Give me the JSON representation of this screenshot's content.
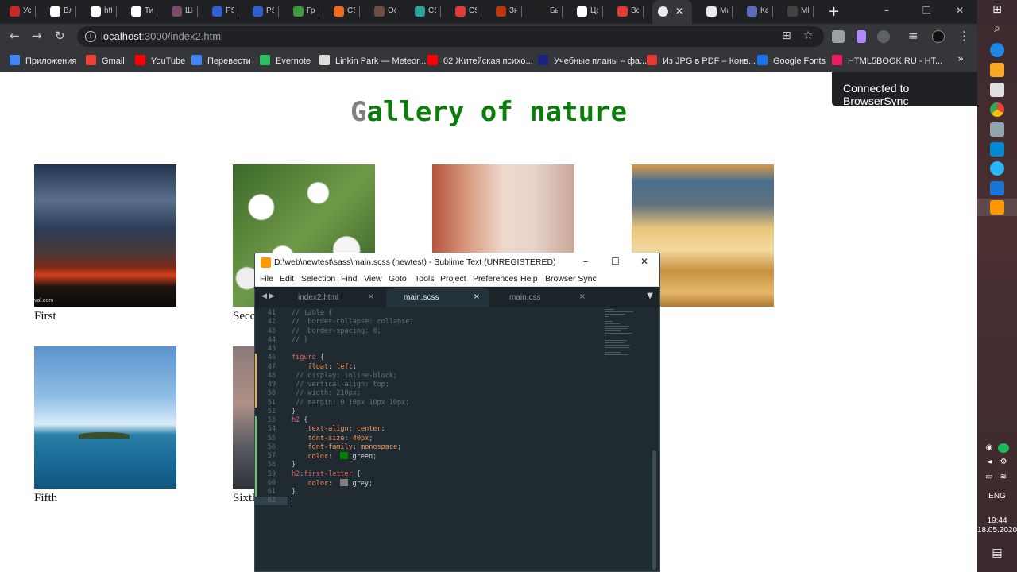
{
  "browser": {
    "tabs": [
      {
        "label": "Усл",
        "color": "#c62828"
      },
      {
        "label": "Вло",
        "color": "#ffffff"
      },
      {
        "label": "http",
        "color": "#ffffff"
      },
      {
        "label": "Тип",
        "color": "#ffffff"
      },
      {
        "label": "Шп",
        "color": "#7b4a6a"
      },
      {
        "label": "PSD",
        "color": "#2f5fd0"
      },
      {
        "label": "PSD",
        "color": "#2f5fd0"
      },
      {
        "label": "Гра",
        "color": "#3e9a3e"
      },
      {
        "label": "CSS",
        "color": "#f06a1c"
      },
      {
        "label": "Осн",
        "color": "#6d4c41"
      },
      {
        "label": "CSS",
        "color": "#26a69a"
      },
      {
        "label": "CSS",
        "color": "#e53935"
      },
      {
        "label": "Зна",
        "color": "#bf360c"
      },
      {
        "label": "Был",
        "color": "#212121"
      },
      {
        "label": "Цен",
        "color": "#ffffff"
      },
      {
        "label": "Все",
        "color": "#e53935"
      },
      {
        "label": "",
        "color": "#e8eaed",
        "active": true,
        "close": "✕"
      },
      {
        "label": "Mai",
        "color": "#e8eaed"
      },
      {
        "label": "Как",
        "color": "#5c6bc0"
      },
      {
        "label": "MP3",
        "color": "#424242"
      }
    ],
    "new_tab": "+",
    "window_controls": {
      "minimize": "–",
      "restore": "❐",
      "close": "✕"
    },
    "url_host": "localhost",
    "url_path": ":3000/index2.html",
    "bookmarks": [
      {
        "label": "Приложения",
        "color": "#4285f4"
      },
      {
        "label": "Gmail",
        "color": "#ea4335"
      },
      {
        "label": "YouTube",
        "color": "#ff0000"
      },
      {
        "label": "Перевести",
        "color": "#4285f4"
      },
      {
        "label": "Evernote",
        "color": "#2dbe60"
      },
      {
        "label": "Linkin Park — Meteor...",
        "color": "#dddddd"
      },
      {
        "label": "02 Житейская психо...",
        "color": "#ff0000"
      },
      {
        "label": "Учебные планы – фа...",
        "color": "#1a237e"
      },
      {
        "label": "Из JPG в PDF – Конв...",
        "color": "#e53935"
      },
      {
        "label": "Google Fonts",
        "color": "#1a73e8"
      },
      {
        "label": "HTML5BOOK.RU - НТ...",
        "color": "#e91e63"
      }
    ],
    "bookmarks_more": "»"
  },
  "page": {
    "title_first": "G",
    "title_rest": "allery of nature",
    "title_color": "#008000",
    "first_letter_color": "#808080",
    "notification": "Connected to BrowserSync",
    "figures": [
      {
        "caption": "First",
        "watermark": "val.com"
      },
      {
        "caption": "Seco"
      },
      {
        "caption": ""
      },
      {
        "caption": "n"
      },
      {
        "caption": "Fifth"
      },
      {
        "caption": "Sixth"
      }
    ]
  },
  "sublime": {
    "title": "D:\\web\\newtest\\sass\\main.scss (newtest) - Sublime Text (UNREGISTERED)",
    "buttons": {
      "minimize": "–",
      "maximize": "☐",
      "close": "✕"
    },
    "menu": [
      "File",
      "Edit",
      "Selection",
      "Find",
      "View",
      "Goto",
      "Tools",
      "Project",
      "Preferences",
      "Help",
      "Browser Sync"
    ],
    "tab_arrows": "◀ ▶",
    "tab_dropdown": "▼",
    "tabs": [
      {
        "name": "index2.html",
        "close": "×",
        "active": false
      },
      {
        "name": "main.scss",
        "close": "×",
        "active": true
      },
      {
        "name": "main.css",
        "close": "×",
        "active": false
      }
    ],
    "lines": [
      {
        "n": "41",
        "t": [
          [
            "cm",
            "// table {"
          ]
        ]
      },
      {
        "n": "42",
        "t": [
          [
            "cm",
            "//  border-collapse: collapse;"
          ]
        ]
      },
      {
        "n": "43",
        "t": [
          [
            "cm",
            "//  border-spacing: 0;"
          ]
        ]
      },
      {
        "n": "44",
        "t": [
          [
            "cm",
            "// }"
          ]
        ]
      },
      {
        "n": "45",
        "t": []
      },
      {
        "n": "46",
        "t": [
          [
            "sel",
            "figure"
          ],
          [
            "pn",
            " {"
          ]
        ],
        "git": "modified"
      },
      {
        "n": "47",
        "t": [
          [
            "plain",
            "    "
          ],
          [
            "prop",
            "float"
          ],
          [
            "pn",
            ": "
          ],
          [
            "val",
            "left"
          ],
          [
            "pn",
            ";"
          ]
        ],
        "git": "modified"
      },
      {
        "n": "48",
        "t": [
          [
            "cm",
            " // display: inline-block;"
          ]
        ],
        "git": "modified"
      },
      {
        "n": "49",
        "t": [
          [
            "cm",
            " // vertical-align: top;"
          ]
        ],
        "git": "modified"
      },
      {
        "n": "50",
        "t": [
          [
            "cm",
            " // width: 210px;"
          ]
        ],
        "git": "modified"
      },
      {
        "n": "51",
        "t": [
          [
            "cm",
            " // margin: 0 10px 10px 10px;"
          ]
        ],
        "git": "modified"
      },
      {
        "n": "52",
        "t": [
          [
            "pn",
            "}"
          ]
        ]
      },
      {
        "n": "53",
        "t": [
          [
            "sel",
            "h2"
          ],
          [
            "pn",
            " {"
          ]
        ],
        "git": "added"
      },
      {
        "n": "54",
        "t": [
          [
            "plain",
            "    "
          ],
          [
            "prop",
            "text-align"
          ],
          [
            "pn",
            ": "
          ],
          [
            "val",
            "center"
          ],
          [
            "pn",
            ";"
          ]
        ],
        "git": "added"
      },
      {
        "n": "55",
        "t": [
          [
            "plain",
            "    "
          ],
          [
            "prop",
            "font-size"
          ],
          [
            "pn",
            ": "
          ],
          [
            "val",
            "40px"
          ],
          [
            "pn",
            ";"
          ]
        ],
        "git": "added"
      },
      {
        "n": "56",
        "t": [
          [
            "plain",
            "    "
          ],
          [
            "prop",
            "font-family"
          ],
          [
            "pn",
            ": "
          ],
          [
            "val",
            "monospace"
          ],
          [
            "pn",
            ";"
          ]
        ],
        "git": "added"
      },
      {
        "n": "57",
        "t": [
          [
            "plain",
            "    "
          ],
          [
            "prop",
            "color"
          ],
          [
            "pn",
            ":  "
          ],
          [
            "swatch",
            "#008000"
          ],
          [
            "plain",
            " green"
          ],
          [
            "pn",
            ";"
          ]
        ],
        "git": "added"
      },
      {
        "n": "58",
        "t": [
          [
            "pn",
            "}"
          ]
        ],
        "git": "added"
      },
      {
        "n": "59",
        "t": [
          [
            "sel",
            "h2"
          ],
          [
            "pn",
            ":"
          ],
          [
            "sel",
            "first-letter"
          ],
          [
            "pn",
            " {"
          ]
        ],
        "git": "added"
      },
      {
        "n": "60",
        "t": [
          [
            "plain",
            "    "
          ],
          [
            "prop",
            "color"
          ],
          [
            "pn",
            ":  "
          ],
          [
            "swatch",
            "#808080"
          ],
          [
            "plain",
            " grey"
          ],
          [
            "pn",
            ";"
          ]
        ],
        "git": "added"
      },
      {
        "n": "61",
        "t": [
          [
            "pn",
            "}"
          ]
        ],
        "git": "added"
      },
      {
        "n": "62",
        "t": [],
        "current": true
      }
    ],
    "git_colors": {
      "modified": "#e5b04a",
      "added": "#6cbf6c"
    }
  },
  "taskbar": {
    "lang": "ENG",
    "time": "19:44",
    "date": "18.05.2020"
  }
}
